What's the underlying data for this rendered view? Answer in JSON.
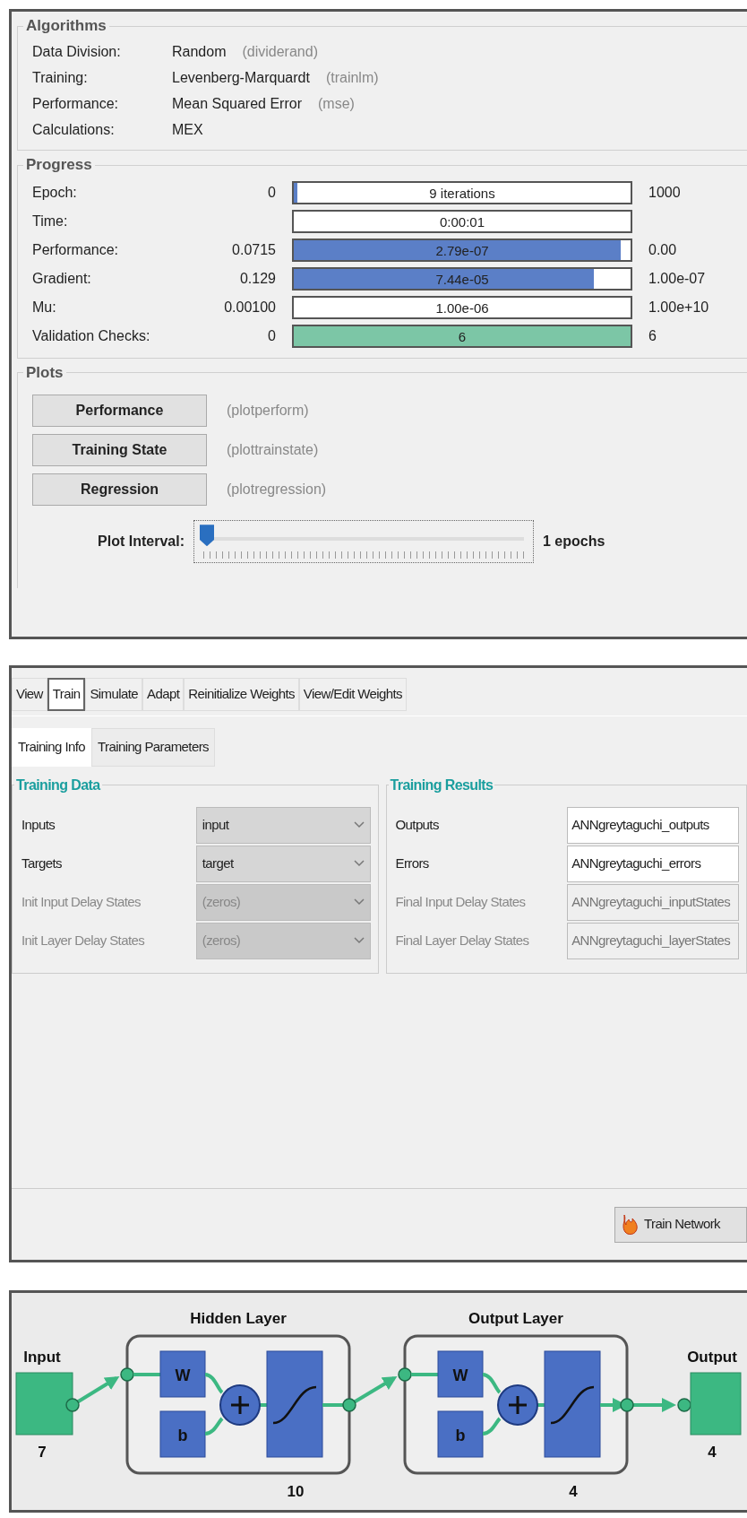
{
  "training_window": {
    "algorithms": {
      "title": "Algorithms",
      "rows": [
        {
          "label": "Data Division:",
          "value": "Random",
          "function": "(dividerand)"
        },
        {
          "label": "Training:",
          "value": "Levenberg-Marquardt",
          "function": "(trainlm)"
        },
        {
          "label": "Performance:",
          "value": "Mean Squared Error",
          "function": "(mse)"
        },
        {
          "label": "Calculations:",
          "value": "MEX"
        }
      ]
    },
    "progress": {
      "title": "Progress",
      "rows": [
        {
          "label": "Epoch:",
          "start": "0",
          "bar_text": "9 iterations",
          "level": 0.01,
          "color": "#5b7fc7",
          "end": "1000"
        },
        {
          "label": "Time:",
          "bar_text": "0:00:01"
        },
        {
          "label": "Performance:",
          "start": "0.0715",
          "bar_text": "2.79e-07",
          "level": 0.97,
          "color": "#5b7fc7",
          "end": "0.00"
        },
        {
          "label": "Gradient:",
          "start": "0.129",
          "bar_text": "7.44e-05",
          "level": 0.89,
          "color": "#5b7fc7",
          "end": "1.00e-07"
        },
        {
          "label": "Mu:",
          "start": "0.00100",
          "bar_text": "1.00e-06",
          "end": "1.00e+10"
        },
        {
          "label": "Validation Checks:",
          "start": "0",
          "bar_text": "6",
          "level": 1,
          "color": "#7cc6a6",
          "end": "6"
        }
      ]
    },
    "plots": {
      "title": "Plots",
      "buttons": [
        {
          "label": "Performance",
          "function": "(plotperform)"
        },
        {
          "label": "Training State",
          "function": "(plottrainstate)"
        },
        {
          "label": "Regression",
          "function": "(plotregression)"
        }
      ],
      "plot_interval": {
        "label": "Plot Interval:",
        "level": 0,
        "reading": "1 epochs"
      }
    }
  },
  "network_manager": {
    "tabs": [
      {
        "label": "View",
        "selected": false
      },
      {
        "label": "Train",
        "selected": true
      },
      {
        "label": "Simulate",
        "selected": false
      },
      {
        "label": "Adapt",
        "selected": false
      },
      {
        "label": "Reinitialize Weights",
        "selected": false
      },
      {
        "label": "View/Edit Weights",
        "selected": false
      }
    ],
    "subtabs": [
      {
        "label": "Training Info",
        "selected": true
      },
      {
        "label": "Training Parameters",
        "selected": false
      }
    ],
    "training_data": {
      "title": "Training Data",
      "rows": [
        {
          "label": "Inputs",
          "value": "input",
          "disabled": false
        },
        {
          "label": "Targets",
          "value": "target",
          "disabled": false
        },
        {
          "label": "Init Input Delay States",
          "value": "(zeros)",
          "disabled": true
        },
        {
          "label": "Init Layer Delay States",
          "value": "(zeros)",
          "disabled": true
        }
      ]
    },
    "training_results": {
      "title": "Training Results",
      "rows": [
        {
          "label": "Outputs",
          "value": "ANNgreytaguchi_outputs",
          "disabled": false
        },
        {
          "label": "Errors",
          "value": "ANNgreytaguchi_errors",
          "disabled": false
        },
        {
          "label": "Final Input Delay States",
          "value": "ANNgreytaguchi_inputStates",
          "disabled": true
        },
        {
          "label": "Final Layer Delay States",
          "value": "ANNgreytaguchi_layerStates",
          "disabled": true
        }
      ]
    },
    "train_button": "Train Network"
  },
  "network_diagram": {
    "input": {
      "label": "Input",
      "size": "7"
    },
    "layers": [
      {
        "title": "Hidden Layer",
        "weight": "W",
        "bias": "b",
        "size": "10"
      },
      {
        "title": "Output Layer",
        "weight": "W",
        "bias": "b",
        "size": "4"
      }
    ],
    "output": {
      "label": "Output",
      "size": "4"
    }
  }
}
